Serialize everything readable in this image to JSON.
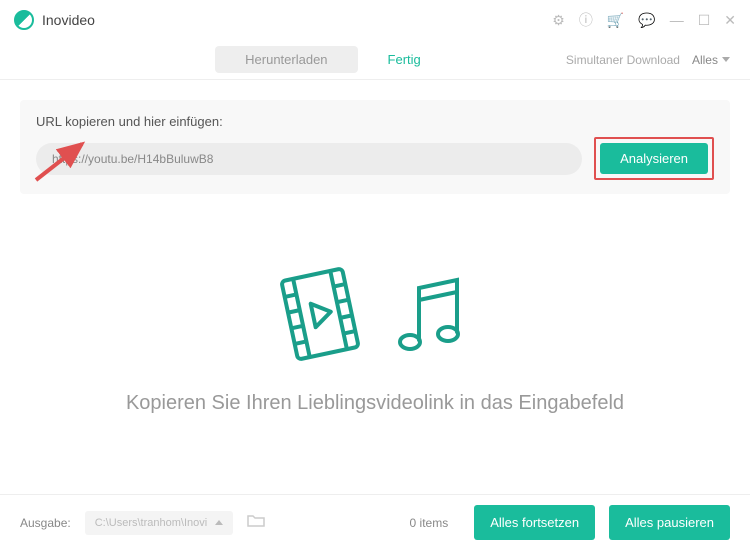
{
  "app": {
    "name": "Inovideo"
  },
  "tabs": {
    "download": "Herunterladen",
    "done": "Fertig"
  },
  "nav_right": {
    "simul": "Simultaner Download",
    "all": "Alles"
  },
  "urlbox": {
    "title": "URL kopieren und hier einfügen:",
    "value": "https://youtu.be/H14bBuluwB8",
    "analyze": "Analysieren"
  },
  "hero": "Kopieren Sie Ihren Lieblingsvideolink in das Eingabefeld",
  "footer": {
    "output_label": "Ausgabe:",
    "path": "C:\\Users\\tranhom\\Inovi",
    "items": "0 items",
    "resume_all": "Alles fortsetzen",
    "pause_all": "Alles pausieren"
  }
}
